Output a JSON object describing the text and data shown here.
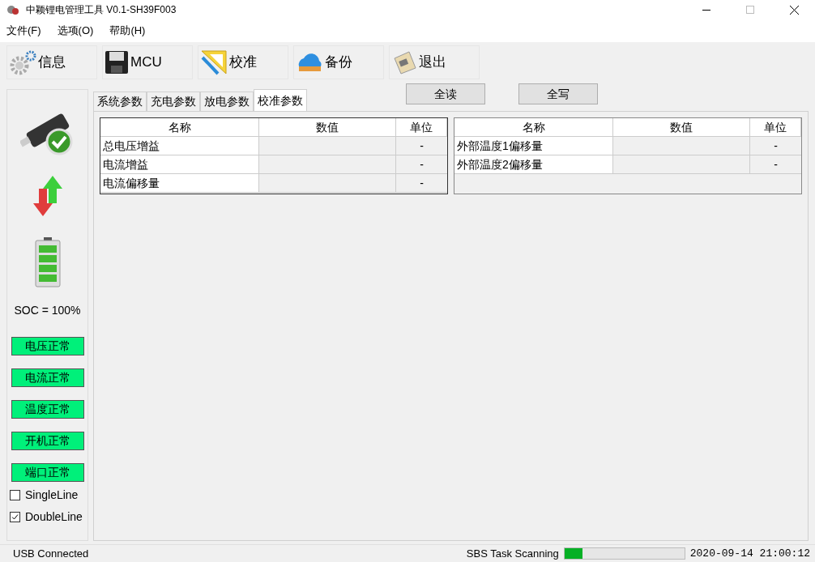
{
  "window": {
    "title": "中颖锂电管理工具 V0.1-SH39F003"
  },
  "menu": [
    "文件(F)",
    "选项(O)",
    "帮助(H)"
  ],
  "toolbar": [
    {
      "kind": "gear",
      "label": "信息"
    },
    {
      "kind": "floppy",
      "label": "MCU"
    },
    {
      "kind": "ruler",
      "label": "校准"
    },
    {
      "kind": "cloud",
      "label": "备份"
    },
    {
      "kind": "exit",
      "label": "退出"
    }
  ],
  "sidebar": {
    "soc": "SOC = 100%",
    "status": [
      "电压正常",
      "电流正常",
      "温度正常",
      "开机正常",
      "端口正常"
    ],
    "options": [
      {
        "label": "SingleLine",
        "checked": false
      },
      {
        "label": "DoubleLine",
        "checked": true
      }
    ]
  },
  "tabs": [
    {
      "label": "系统参数",
      "selected": false
    },
    {
      "label": "充电参数",
      "selected": false
    },
    {
      "label": "放电参数",
      "selected": false
    },
    {
      "label": "校准参数",
      "selected": true
    }
  ],
  "actions": [
    "全读",
    "全写"
  ],
  "tables": [
    {
      "columns": [
        "名称",
        "数值",
        "单位"
      ],
      "rows": [
        [
          "总电压增益",
          "",
          "-"
        ],
        [
          "电流增益",
          "",
          "-"
        ],
        [
          "电流偏移量",
          "",
          "-"
        ]
      ]
    },
    {
      "columns": [
        "名称",
        "数值",
        "单位"
      ],
      "rows": [
        [
          "外部温度1偏移量",
          "",
          "-"
        ],
        [
          "外部温度2偏移量",
          "",
          "-"
        ]
      ]
    }
  ],
  "status_bar": {
    "connection": "USB Connected",
    "task": "SBS Task Scanning",
    "level": 0.15,
    "time": "2020-09-14 21:00:12"
  }
}
